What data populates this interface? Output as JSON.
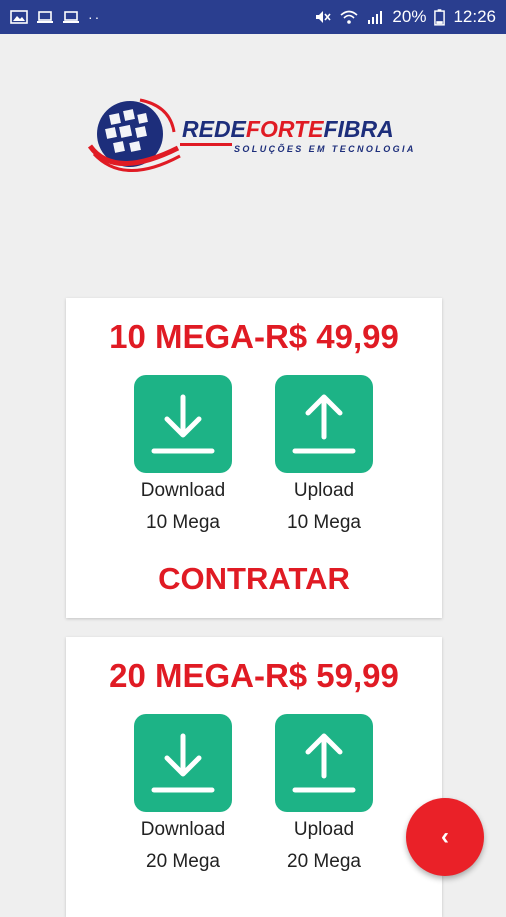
{
  "status_bar": {
    "battery": "20%",
    "time": "12:26",
    "dots": "··"
  },
  "logo": {
    "rede": "REDE",
    "forte": "FORTE",
    "fibra": "FIBRA",
    "tagline": "SOLUÇÕES EM TECNOLOGIA"
  },
  "plans": [
    {
      "title": "10 MEGA-R$ 49,99",
      "download_label": "Download",
      "download_speed": "10 Mega",
      "upload_label": "Upload",
      "upload_speed": "10 Mega",
      "cta": "CONTRATAR"
    },
    {
      "title": "20 MEGA-R$ 59,99",
      "download_label": "Download",
      "download_speed": "20 Mega",
      "upload_label": "Upload",
      "upload_speed": "20 Mega"
    }
  ],
  "fab": {
    "icon": "chevron-left-icon",
    "glyph": "‹"
  },
  "colors": {
    "status_bar": "#2a3e8f",
    "accent_red": "#e01b24",
    "tile_green": "#1db386",
    "background": "#efefef"
  }
}
